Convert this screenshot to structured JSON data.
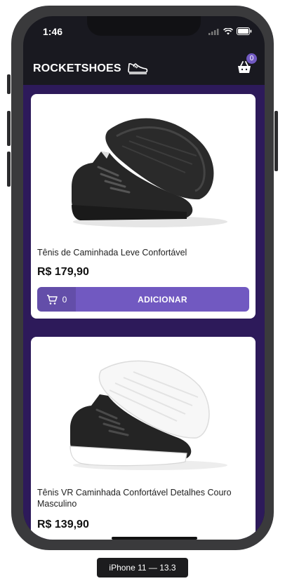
{
  "status_bar": {
    "time": "1:46"
  },
  "header": {
    "brand": "ROCKETSHOES",
    "cart_count": "0"
  },
  "colors": {
    "accent": "#7159c1",
    "background": "#2d1a5a",
    "header": "#191920"
  },
  "products": [
    {
      "title": "Tênis de Caminhada Leve Confortável",
      "price": "R$ 179,90",
      "cart_amount": "0",
      "button_label": "ADICIONAR",
      "image": "black-sneaker-with-black-sole"
    },
    {
      "title": "Tênis VR Caminhada Confortável Detalhes Couro Masculino",
      "price": "R$ 139,90",
      "image": "black-sneaker-with-white-sole"
    }
  ],
  "device_label": "iPhone 11 — 13.3"
}
